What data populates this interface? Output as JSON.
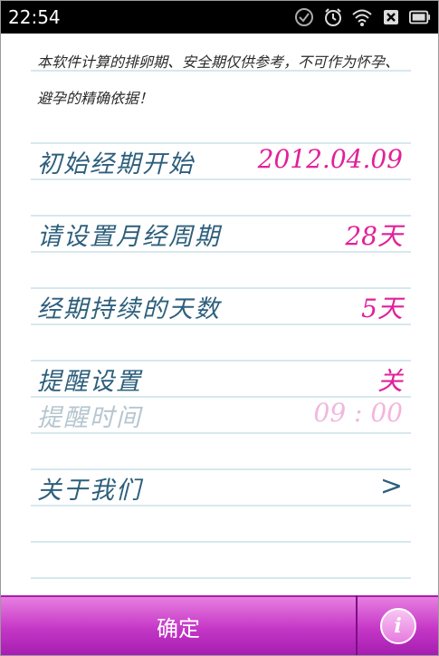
{
  "status_bar": {
    "time": "22:54",
    "icons": [
      "check-circle-icon",
      "alarm-clock-icon",
      "wifi-icon",
      "no-sim-icon",
      "battery-icon"
    ]
  },
  "disclaimer": "本软件计算的排卵期、安全期仅供参考，不可作为怀孕、避孕的精确依据！",
  "settings": [
    {
      "label": "初始经期开始",
      "value": "2012.04.09"
    },
    {
      "label": "请设置月经周期",
      "value": "28天"
    },
    {
      "label": "经期持续的天数",
      "value": "5天"
    },
    {
      "label": "提醒设置",
      "value": "关"
    },
    {
      "label": "提醒时间",
      "value": "09 : 00"
    },
    {
      "label": "关于我们",
      "value": ">"
    }
  ],
  "bottom_bar": {
    "confirm_label": "确定",
    "info_label": "i"
  },
  "colors": {
    "label": "#2d5f7c",
    "value": "#e0219a",
    "disabled_label": "#b6c6cf",
    "disabled_value": "#f2b6dc",
    "bar": "#c437c6"
  }
}
